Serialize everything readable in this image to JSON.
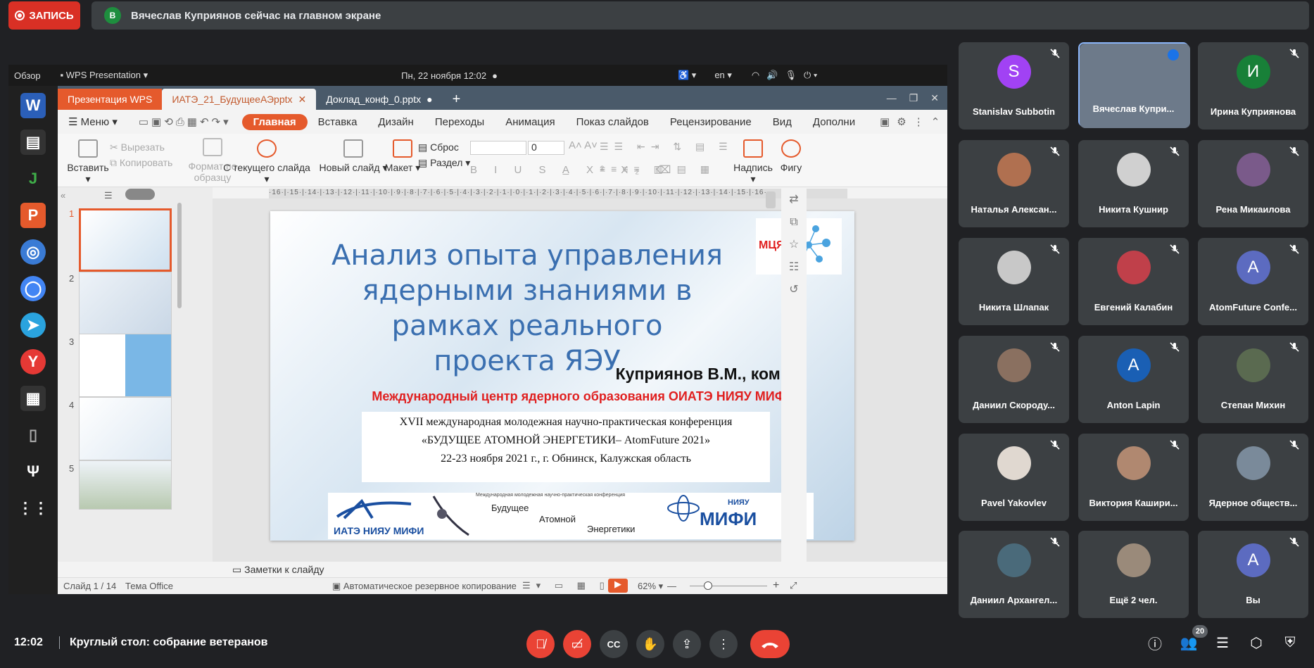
{
  "meet": {
    "record_label": "ЗАПИСЬ",
    "banner_initial": "В",
    "banner_text": "Вячеслав Куприянов сейчас на главном экране",
    "time": "12:02",
    "meeting_title": "Круглый стол: собрание ветеранов",
    "participants_count": "20"
  },
  "screen": {
    "sysbar": {
      "overview": "Обзор",
      "app_menu": "WPS Presentation",
      "clock": "Пн, 22 ноября  12:02",
      "lang": "en"
    },
    "tabs": [
      "Презентация WPS",
      "ИАТЭ_21_БудущееАЭpptx",
      "Доклад_конф_0.pptx"
    ],
    "menu": {
      "menu_label": "Меню",
      "items": [
        "Главная",
        "Вставка",
        "Дизайн",
        "Переходы",
        "Анимация",
        "Показ слайдов",
        "Рецензирование",
        "Вид",
        "Дополни"
      ]
    },
    "ribbon": {
      "paste": "Вставить",
      "cut": "Вырезать",
      "copy": "Копировать",
      "format_painter_1": "Формат по",
      "format_painter_2": "образцу",
      "from_current": "С текущего слайда",
      "new_slide": "Новый слайд",
      "layout": "Макет",
      "reset": "Сброс",
      "section": "Раздел",
      "font_size": "0",
      "textbox": "Надпись",
      "shapes": "Фигу"
    },
    "ruler": "·16·|·15·|·14·|·13·|·12·|·11·|·10·|·9·|·8·|·7·|·6·|·5·|·4·|·3·|·2·|·1·|·0·|·1·|·2·|·3·|·4·|·5·|·6·|·7·|·8·|·9·|·10·|·11·|·12·|·13·|·14·|·15·|·16·",
    "thumbnails": [
      "1",
      "2",
      "3",
      "4",
      "5"
    ],
    "slide": {
      "title": "Анализ опыта управления ядерными знаниями в рамках реального проекта ЯЭУ",
      "author": "Куприянов В.М., комн,",
      "org": "Международный центр ядерного образования ОИАТЭ НИЯУ МИФИ",
      "conf_line1": "XVII международная молодежная научно-практическая конференция",
      "conf_line2": "«БУДУЩЕЕ АТОМНОЙ ЭНЕРГЕТИКИ– AtomFuture 2021»",
      "conf_line3": "22-23 ноября 2021 г., г. Обнинск, Калужская область",
      "logo_left": "ИАТЭ НИЯУ МИФИ",
      "logo_mid_caption": "Международная молодежная научно-практическая конференция",
      "logo_mid_1": "Будущее",
      "logo_mid_2": "Атомной",
      "logo_mid_3": "Энергетики",
      "logo_right_top": "НИЯУ",
      "logo_right": "МИФИ",
      "badge": "МЦЯО"
    },
    "notes": "Заметки к слайду",
    "status": {
      "slide_num": "Слайд 1 / 14",
      "theme": "Тема Office",
      "autosave": "Автоматическое резервное копирование",
      "zoom": "62%"
    }
  },
  "participants": [
    {
      "name": "Stanislav Subbotin",
      "initial": "S",
      "color": "#a142f4"
    },
    {
      "name": "Вячеслав Купри...",
      "initial": "",
      "color": "#6d7a8a"
    },
    {
      "name": "Ирина Куприянова",
      "initial": "И",
      "color": "#188038"
    },
    {
      "name": "Наталья Алексан...",
      "initial": "",
      "color": "#b07050"
    },
    {
      "name": "Никита Кушнир",
      "initial": "",
      "color": "#d0d0d0"
    },
    {
      "name": "Рена Микаилова",
      "initial": "",
      "color": "#7a5a8a"
    },
    {
      "name": "Никита Шлапак",
      "initial": "",
      "color": "#c8c8c8"
    },
    {
      "name": "Евгений Калабин",
      "initial": "",
      "color": "#c0404a"
    },
    {
      "name": "AtomFuture Confe...",
      "initial": "A",
      "color": "#5c6bc0"
    },
    {
      "name": "Даниил Скороду...",
      "initial": "",
      "color": "#8a7060"
    },
    {
      "name": "Anton Lapin",
      "initial": "A",
      "color": "#1a5fb4"
    },
    {
      "name": "Степан Михин",
      "initial": "",
      "color": "#5a6a50"
    },
    {
      "name": "Pavel Yakovlev",
      "initial": "",
      "color": "#e0d8d0"
    },
    {
      "name": "Виктория Кашири...",
      "initial": "",
      "color": "#b08870"
    },
    {
      "name": "Ядерное обществ...",
      "initial": "",
      "color": "#7a8a9a"
    },
    {
      "name": "Даниил Архангел...",
      "initial": "",
      "color": "#4a6a7a"
    },
    {
      "name": "Ещё 2 чел.",
      "initial": "",
      "color": "#9a8a7a"
    },
    {
      "name": "Вы",
      "initial": "A",
      "color": "#5c6bc0"
    }
  ]
}
